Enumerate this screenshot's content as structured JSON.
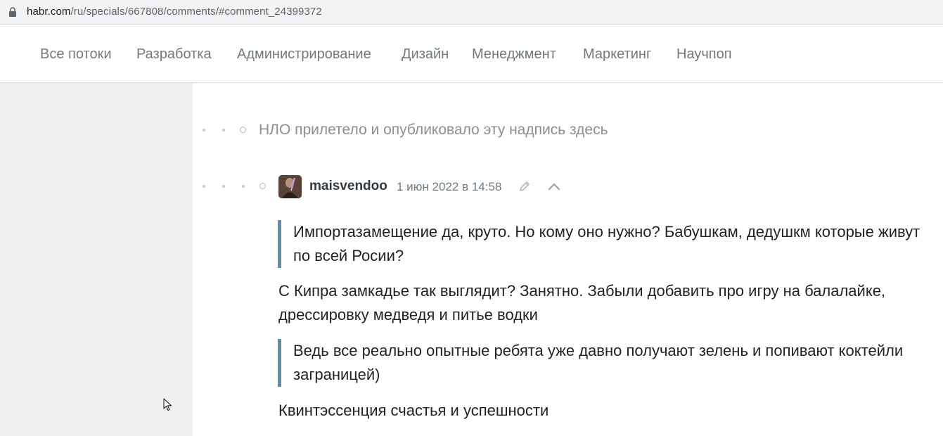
{
  "browser": {
    "url_host": "habr.com",
    "url_path": "/ru/specials/667808/comments/#comment_24399372"
  },
  "nav": {
    "items": [
      "Все потоки",
      "Разработка",
      "Администрирование",
      "Дизайн",
      "Менеджмент",
      "Маркетинг",
      "Научпоп"
    ]
  },
  "comments": {
    "ufo_notice": "НЛО прилетело и опубликовало эту надпись здесь",
    "reply": {
      "author": "maisvendoo",
      "date": "1 июн 2022 в 14:58",
      "quote1": "Импортазамещение да, круто. Но кому оно нужно? Бабушкам, дедушкм которые живут по всей Росии?",
      "paragraph1": "С Кипра замкадье так выглядит? Занятно. Забыли добавить про игру на балалайке, дрессировку медведя и питье водки",
      "quote2": "Ведь все реально опытные ребята уже давно получают зелень и попивают коктейли заграницей)",
      "paragraph2": "Квинтэссенция счастья и успешности"
    }
  },
  "colors": {
    "quote_border": "#5e8ea8",
    "nav_text": "#707a80",
    "left_pane": "#f0f0f0"
  }
}
